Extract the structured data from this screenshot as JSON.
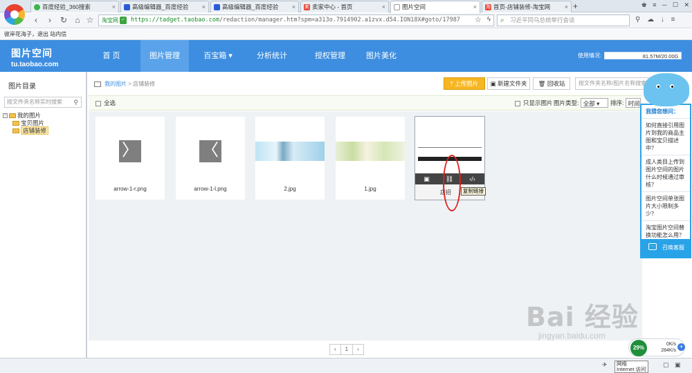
{
  "browser": {
    "tabs": [
      {
        "label": "百度经验_360搜索",
        "icon_color": "#3bb54a"
      },
      {
        "label": "高级编辑器_百度经验",
        "icon_color": "#2a5bd7"
      },
      {
        "label": "高级编辑器_百度经验",
        "icon_color": "#2a5bd7"
      },
      {
        "label": "卖家中心 - 首页",
        "icon_color": "#e8412f"
      },
      {
        "label": "图片空间",
        "icon_color": "#999999"
      },
      {
        "label": "首页-店铺装修-淘宝网",
        "icon_color": "#e8412f"
      }
    ],
    "active_tab": 4,
    "site_badge": "淘宝网",
    "url_main": "https://tadget.taobao.com",
    "url_rest": "/redaction/manager.htm?spm=a313o.7914902.a1zvx.d54.ION18X#goto/17987",
    "search_text": "习近平同乌总统举行会谈",
    "bookmarks": "彼岸花海子，退出  站内信"
  },
  "header": {
    "logo_line1": "图片空间",
    "logo_line2": "tu.taobao.com",
    "nav": [
      "首 页",
      "图片管理",
      "百宝箱 ▾",
      "分析统计",
      "授权管理",
      "图片美化"
    ],
    "active_nav": 1,
    "usage_label": "使用情况:",
    "usage_value": "81.57M/20.00G",
    "usage_fraction": 0.004
  },
  "sidebar": {
    "title": "图片目录",
    "search_placeholder": "按文件夹名称实时搜索",
    "tree": {
      "root": "我的图片",
      "children": [
        "宝贝图片",
        "店铺装修"
      ],
      "selected": "店铺装修"
    }
  },
  "main": {
    "breadcrumb_root": "我的图片",
    "breadcrumb_sep": ">",
    "breadcrumb_current": "店铺装修",
    "upload_label": "上传图片",
    "new_folder_label": "新建文件夹",
    "recycle_label": "回收站",
    "search_placeholder": "按文件夹名称/图片名称搜索",
    "select_all_label": "全选",
    "only_pics_label": "只显示图片",
    "type_label": "图片类型:",
    "type_value": "全部",
    "sort_label": "排序:",
    "sort_value": "时间"
  },
  "files": [
    {
      "name": "arrow-1-r.png",
      "kind": "arrow-right"
    },
    {
      "name": "arrow-1-l.png",
      "kind": "arrow-left"
    },
    {
      "name": "2.jpg",
      "kind": "banner-blue"
    },
    {
      "name": "1.jpg",
      "kind": "banner-green"
    },
    {
      "name": "店招",
      "kind": "hovered",
      "tooltip": "复制链接"
    }
  ],
  "pager": {
    "prev": "‹",
    "page": "1",
    "next": "›"
  },
  "help": {
    "header": "我猜您想问：",
    "questions": [
      "如何直接引用图片到我的商品主图和宝贝描述中？",
      "成人类目上传到图片空间的图片什么时候通过审核？",
      "图片空间单张图片大小限制多少？",
      "淘宝图片空间替换功能怎么用？"
    ],
    "footer": "召唤客服"
  },
  "status": {
    "speed_pct": "29%",
    "up": "0K/s",
    "down": "284K/s",
    "net_line1": "网络",
    "net_line2": "Internet 访问"
  },
  "watermark": {
    "line1": "Bai 经验",
    "line2": "jingyan.baidu.com"
  },
  "colors": {
    "brand_blue": "#3d8ee0",
    "upload_orange": "#f7b723",
    "help_blue": "#29a3e8",
    "annotation_red": "#e0201a"
  }
}
